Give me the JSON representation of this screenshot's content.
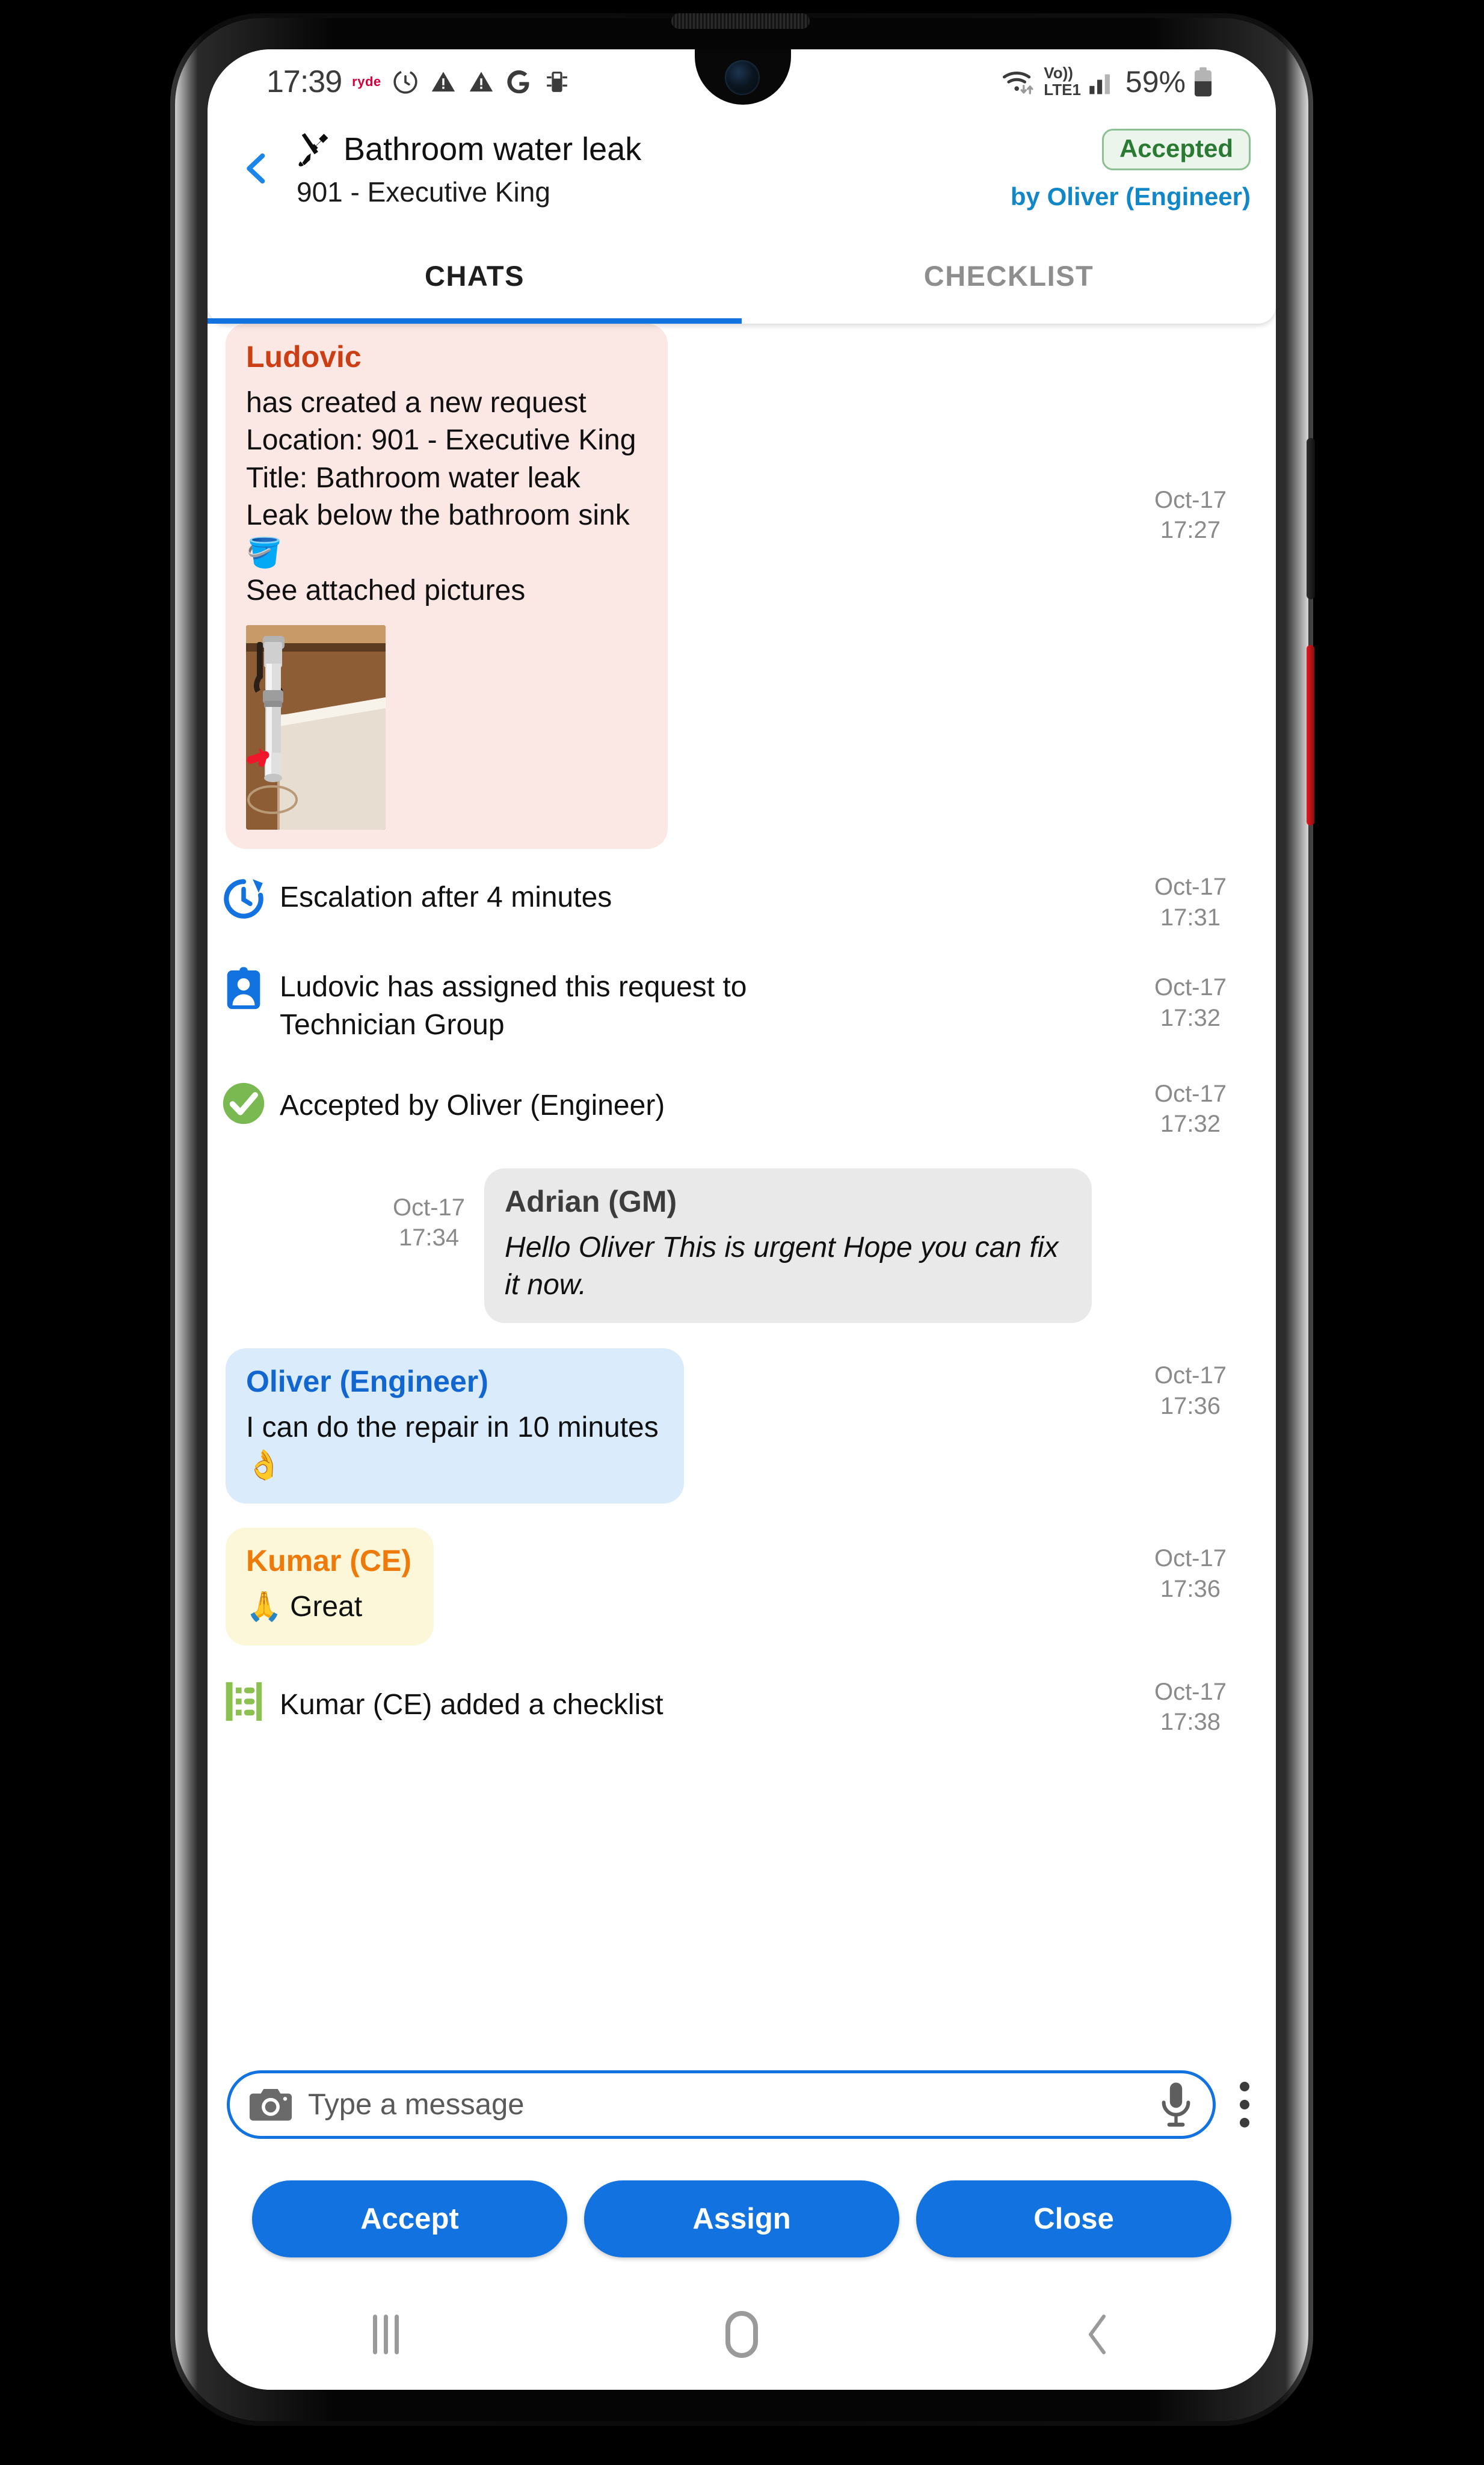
{
  "status_bar": {
    "time": "17:39",
    "carrier_logo": "ryde",
    "left_icons": [
      "sync-icon",
      "warning-triangle-icon",
      "warning-triangle-icon",
      "google-g-icon",
      "sd-card-icon"
    ],
    "right_icons": [
      "wifi-icon",
      "volte-lte1-icon",
      "signal-bars-icon"
    ],
    "network_label": "Vo))",
    "network_label2": "LTE1",
    "battery_percent": "59%"
  },
  "header": {
    "back_icon": "chevron-left-icon",
    "task_icon": "tools-icon",
    "title": "Bathroom water leak",
    "subtitle": "901 - Executive King",
    "status_badge": "Accepted",
    "assignee_line": "by Oliver (Engineer)",
    "accent_color": "#1273e0",
    "badge_text_color": "#2a7a33",
    "badge_bg_color": "#ebf5ec"
  },
  "tabs": [
    {
      "label": "CHATS",
      "active": true
    },
    {
      "label": "CHECKLIST",
      "active": false
    }
  ],
  "chat": [
    {
      "kind": "bubble",
      "sender": "Ludovic",
      "sender_color": "#cc3e13",
      "bubble_color": "#fbe7e3",
      "lines": [
        "has created a new request",
        "Location: 901 - Executive King",
        "Title: Bathroom water leak",
        "Leak below the bathroom sink 🪣",
        "See attached pictures"
      ],
      "attachment": "sink-pipe-photo",
      "date": "Oct-17",
      "time": "17:27"
    },
    {
      "kind": "event",
      "icon": "clock-refresh-icon",
      "icon_color": "#1273e0",
      "text": "Escalation after 4 minutes",
      "date": "Oct-17",
      "time": "17:31"
    },
    {
      "kind": "event",
      "icon": "assign-badge-icon",
      "icon_color": "#1273e0",
      "text": "Ludovic has assigned this request to Technician Group",
      "date": "Oct-17",
      "time": "17:32"
    },
    {
      "kind": "event",
      "icon": "check-circle-icon",
      "icon_color": "#79b852",
      "text": "Accepted by Oliver (Engineer)",
      "date": "Oct-17",
      "time": "17:32"
    },
    {
      "kind": "bubble-right",
      "sender": "Adrian (GM)",
      "sender_color": "#3c3c3c",
      "bubble_color": "#e9e9e9",
      "text": "Hello Oliver This is urgent Hope you can fix it now.",
      "italic": true,
      "date": "Oct-17",
      "time": "17:34"
    },
    {
      "kind": "bubble",
      "sender": "Oliver (Engineer)",
      "sender_color": "#1266cf",
      "bubble_color": "#daebfb",
      "text": "I can do the repair in 10 minutes 👌",
      "date": "Oct-17",
      "time": "17:36"
    },
    {
      "kind": "bubble",
      "sender": "Kumar (CE)",
      "sender_color": "#ef7a0c",
      "bubble_color": "#fcf7d8",
      "text": "🙏 Great",
      "date": "Oct-17",
      "time": "17:36"
    },
    {
      "kind": "event",
      "icon": "checklist-icon",
      "icon_color": "#8cc152",
      "text": "Kumar (CE) added a checklist",
      "date": "Oct-17",
      "time": "17:38"
    }
  ],
  "input": {
    "camera_icon": "camera-icon",
    "placeholder": "Type a message",
    "value": "",
    "mic_icon": "microphone-icon",
    "overflow_icon": "kebab-menu-icon"
  },
  "actions": [
    {
      "label": "Accept"
    },
    {
      "label": "Assign"
    },
    {
      "label": "Close"
    }
  ],
  "nav_bar": {
    "recents_icon": "recents-icon",
    "home_icon": "home-icon",
    "back_icon": "back-icon"
  }
}
